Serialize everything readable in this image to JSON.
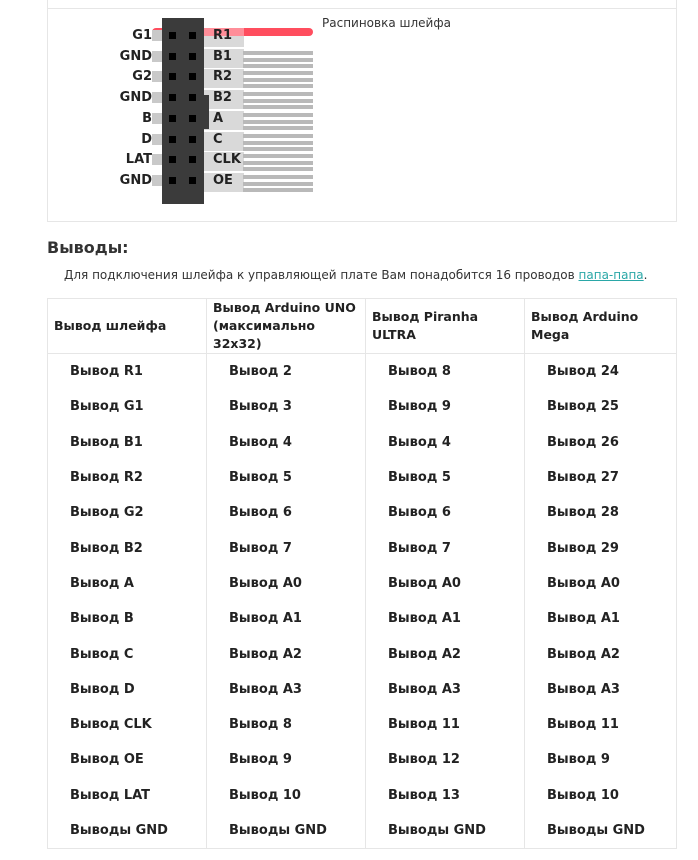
{
  "diagram": {
    "caption": "Распиновка шлейфа",
    "left_pins": [
      "G1",
      "GND",
      "G2",
      "GND",
      "B",
      "D",
      "LAT",
      "GND"
    ],
    "right_pins": [
      "R1",
      "B1",
      "R2",
      "B2",
      "A",
      "C",
      "CLK",
      "OE"
    ],
    "highlight_color": "#ff4d5e"
  },
  "section": {
    "title": "Выводы:",
    "intro_text": "Для подключения шлейфа к управляющей плате Вам понадобится 16 проводов ",
    "intro_link": "папа-папа",
    "intro_end": "."
  },
  "table": {
    "headers": [
      "Вывод шлейфа",
      "Вывод Arduino UNO (максимально 32x32)",
      "Вывод Piranha ULTRA",
      "Вывод Arduino Mega"
    ],
    "rows": [
      [
        "Вывод R1",
        "Вывод 2",
        "Вывод 8",
        "Вывод 24"
      ],
      [
        "Вывод G1",
        "Вывод 3",
        "Вывод 9",
        "Вывод 25"
      ],
      [
        "Вывод B1",
        "Вывод 4",
        "Вывод 4",
        "Вывод 26"
      ],
      [
        "Вывод R2",
        "Вывод 5",
        "Вывод 5",
        "Вывод 27"
      ],
      [
        "Вывод G2",
        "Вывод 6",
        "Вывод 6",
        "Вывод 28"
      ],
      [
        "Вывод B2",
        "Вывод 7",
        "Вывод 7",
        "Вывод 29"
      ],
      [
        "Вывод A",
        "Вывод A0",
        "Вывод A0",
        "Вывод A0"
      ],
      [
        "Вывод B",
        "Вывод A1",
        "Вывод A1",
        "Вывод A1"
      ],
      [
        "Вывод C",
        "Вывод A2",
        "Вывод A2",
        "Вывод A2"
      ],
      [
        "Вывод D",
        "Вывод A3",
        "Вывод A3",
        "Вывод A3"
      ],
      [
        "Вывод CLK",
        "Вывод 8",
        "Вывод 11",
        "Вывод 11"
      ],
      [
        "Вывод OE",
        "Вывод 9",
        "Вывод 12",
        "Вывод 9"
      ],
      [
        "Вывод LAT",
        "Вывод 10",
        "Вывод 13",
        "Вывод 10"
      ],
      [
        "Выводы GND",
        "Выводы GND",
        "Выводы GND",
        "Выводы GND"
      ]
    ]
  }
}
